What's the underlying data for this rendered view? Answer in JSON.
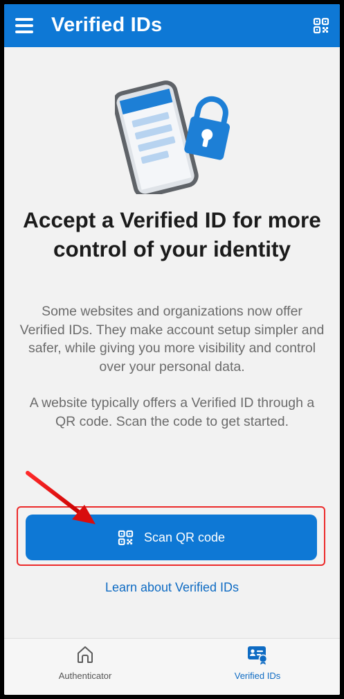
{
  "header": {
    "title": "Verified IDs",
    "menu_icon": "hamburger-menu-icon",
    "qr_icon": "qr-code-icon"
  },
  "illustration": {
    "icon": "phone-with-lock-illustration"
  },
  "main": {
    "headline": "Accept a Verified ID for more control of your identity",
    "paragraph_1": "Some websites and organizations now offer Verified IDs. They make account setup simpler and safer, while giving you more visibility and control over your personal data.",
    "paragraph_2": "A website typically offers a Verified ID through a QR code. Scan the code to get started.",
    "scan_button_label": "Scan QR code",
    "learn_link": "Learn about Verified IDs"
  },
  "nav": {
    "items": [
      {
        "label": "Authenticator",
        "icon": "home-icon",
        "active": false
      },
      {
        "label": "Verified IDs",
        "icon": "verified-id-card-icon",
        "active": true
      }
    ]
  },
  "colors": {
    "brand": "#0e78d5",
    "link": "#0e6bc3",
    "annotation": "#ec2a2a",
    "background": "#f2f2f2"
  }
}
